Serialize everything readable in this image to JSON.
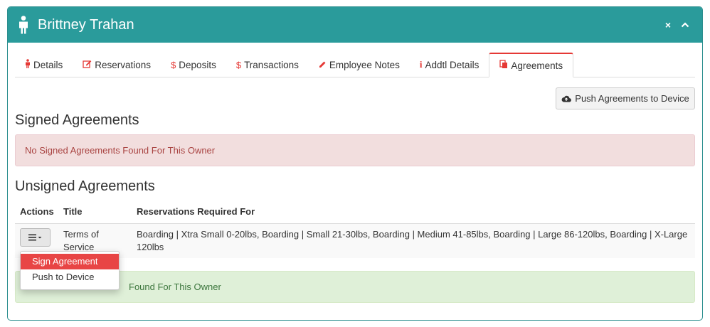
{
  "header": {
    "owner_name": "Brittney Trahan",
    "icon": "person-icon",
    "close_symbol": "×",
    "collapse_symbol": "⌃"
  },
  "tabs": [
    {
      "label": "Details",
      "icon": "person-icon"
    },
    {
      "label": "Reservations",
      "icon": "edit-icon"
    },
    {
      "label": "Deposits",
      "icon": "dollar-icon"
    },
    {
      "label": "Transactions",
      "icon": "dollar-icon"
    },
    {
      "label": "Employee Notes",
      "icon": "pencil-icon"
    },
    {
      "label": "Addtl Details",
      "icon": "info-icon"
    },
    {
      "label": "Agreements",
      "icon": "files-icon",
      "active": true
    }
  ],
  "push_button": {
    "label": "Push Agreements to Device",
    "icon": "cloud-upload-icon"
  },
  "signed": {
    "heading": "Signed Agreements",
    "empty_message": "No Signed Agreements Found For This Owner"
  },
  "unsigned": {
    "heading": "Unsigned Agreements",
    "columns": {
      "actions": "Actions",
      "title": "Title",
      "reservations": "Reservations Required For"
    },
    "rows": [
      {
        "title": "Terms of Service",
        "reservations": "Boarding | Xtra Small 0-20lbs, Boarding | Small 21-30lbs, Boarding | Medium 41-85lbs, Boarding | Large 86-120lbs, Boarding | X-Large 120lbs"
      }
    ],
    "bottom_message": "No Unsigned Agreements Found For This Owner",
    "bottom_message_visible": "Found For This Owner"
  },
  "dropdown": {
    "items": [
      {
        "label": "Sign Agreement",
        "active": true
      },
      {
        "label": "Push to Device",
        "active": false
      }
    ]
  },
  "colors": {
    "header_teal": "#2a9b9b",
    "accent_red": "#e53935",
    "danger_bg": "#f2dede",
    "success_bg": "#dff0d8"
  }
}
